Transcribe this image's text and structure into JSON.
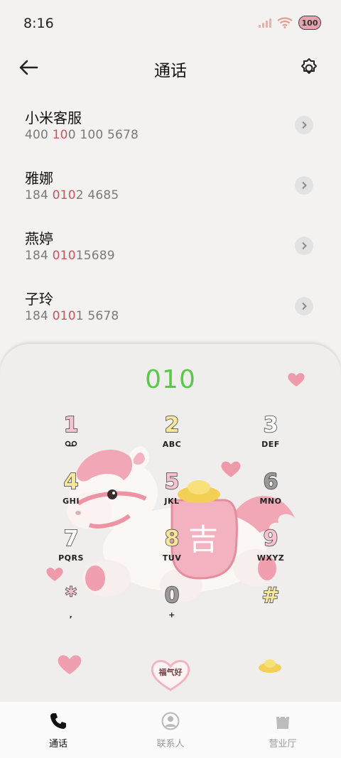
{
  "status": {
    "time": "8:16",
    "battery": "100",
    "signal_icon": "signal-icon",
    "wifi_icon": "wifi-icon"
  },
  "header": {
    "title": "通话",
    "back_icon": "arrow-left-icon",
    "settings_icon": "gear-icon"
  },
  "contacts": [
    {
      "name": "小米客服",
      "pre": "400 ",
      "match": "10",
      "post": "0 100 5678"
    },
    {
      "name": "雅娜",
      "pre": "184 ",
      "match": "010",
      "post": "2 4685"
    },
    {
      "name": "燕婷",
      "pre": "184 ",
      "match": "010",
      "post": "15689"
    },
    {
      "name": "子玲",
      "pre": "184 ",
      "match": "010",
      "post": "1 5678"
    }
  ],
  "dialpad": {
    "input": "010",
    "keys": [
      {
        "digit": "1",
        "letters": "voicemail-icon"
      },
      {
        "digit": "2",
        "letters": "ABC"
      },
      {
        "digit": "3",
        "letters": "DEF"
      },
      {
        "digit": "4",
        "letters": "GHI"
      },
      {
        "digit": "5",
        "letters": "JKL"
      },
      {
        "digit": "6",
        "letters": "MNO"
      },
      {
        "digit": "7",
        "letters": "PQRS"
      },
      {
        "digit": "8",
        "letters": "TUV"
      },
      {
        "digit": "9",
        "letters": "WXYZ"
      },
      {
        "digit": "*",
        "letters": ","
      },
      {
        "digit": "0",
        "letters": "+"
      },
      {
        "digit": "#",
        "letters": ""
      }
    ],
    "mascot_badge": "吉",
    "call_button_text": "福气好"
  },
  "nav": {
    "items": [
      {
        "label": "通话",
        "icon": "phone-icon",
        "active": true
      },
      {
        "label": "联系人",
        "icon": "person-icon",
        "active": false
      },
      {
        "label": "营业厅",
        "icon": "shopping-bag-icon",
        "active": false
      }
    ]
  },
  "colors": {
    "accent_green": "#5ac84a",
    "highlight_red": "#c9545c",
    "background": "#f3f2f1"
  }
}
